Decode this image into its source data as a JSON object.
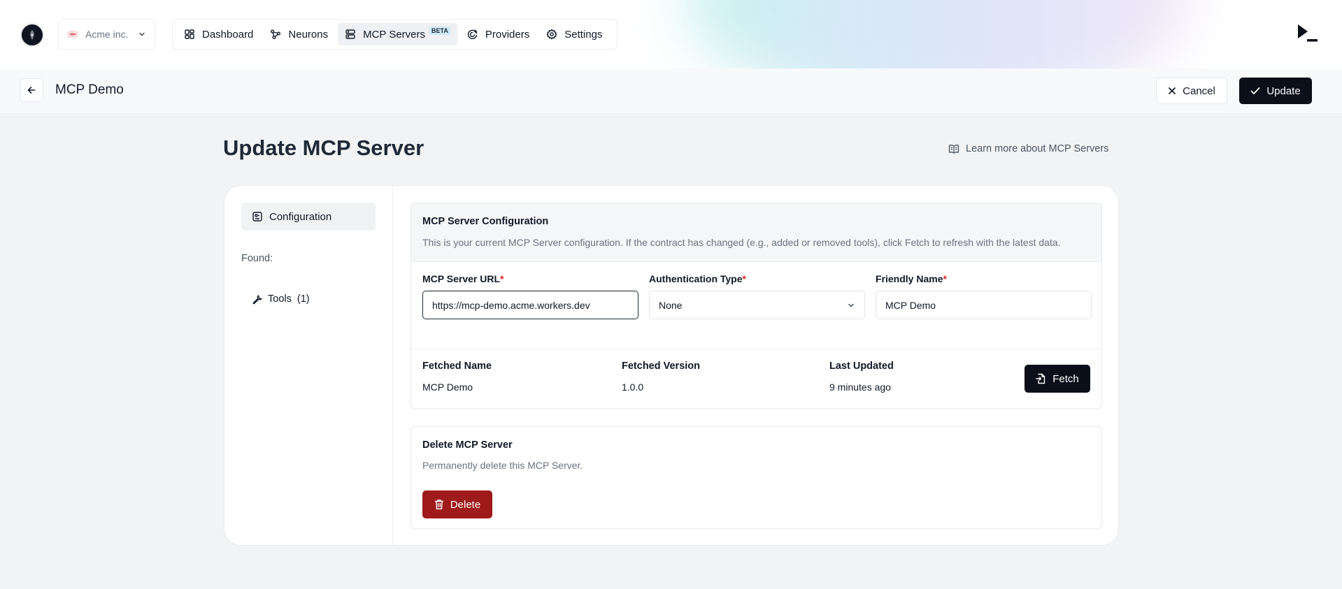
{
  "topbar": {
    "org": {
      "name": "Acme inc."
    },
    "nav": [
      {
        "label": "Dashboard",
        "icon": "dashboard-icon"
      },
      {
        "label": "Neurons",
        "icon": "neurons-icon"
      },
      {
        "label": "MCP Servers",
        "icon": "server-icon",
        "badge": "BETA",
        "active": true
      },
      {
        "label": "Providers",
        "icon": "providers-icon"
      },
      {
        "label": "Settings",
        "icon": "gear-icon"
      }
    ]
  },
  "subheader": {
    "title": "MCP Demo",
    "cancel_label": "Cancel",
    "update_label": "Update"
  },
  "page": {
    "title": "Update MCP Server",
    "learn_more": "Learn more about MCP Servers"
  },
  "sidebar": {
    "configuration_label": "Configuration",
    "found_label": "Found:",
    "tools_label": "Tools",
    "tools_count": "(1)"
  },
  "config": {
    "title": "MCP Server Configuration",
    "description": "This is your current MCP Server configuration. If the contract has changed (e.g., added or removed tools), click Fetch to refresh with the latest data.",
    "url_label": "MCP Server URL",
    "url_value": "https://mcp-demo.acme.workers.dev",
    "auth_label": "Authentication Type",
    "auth_value": "None",
    "name_label": "Friendly Name",
    "name_value": "MCP Demo",
    "required_mark": "*",
    "fetched_name_label": "Fetched Name",
    "fetched_name_value": "MCP Demo",
    "fetched_version_label": "Fetched Version",
    "fetched_version_value": "1.0.0",
    "last_updated_label": "Last Updated",
    "last_updated_value": "9 minutes ago",
    "fetch_label": "Fetch"
  },
  "delete": {
    "title": "Delete MCP Server",
    "description": "Permanently delete this MCP Server.",
    "button_label": "Delete"
  },
  "colors": {
    "primary": "#0b0f19",
    "danger": "#9f1a1a",
    "required": "#dc2626"
  }
}
